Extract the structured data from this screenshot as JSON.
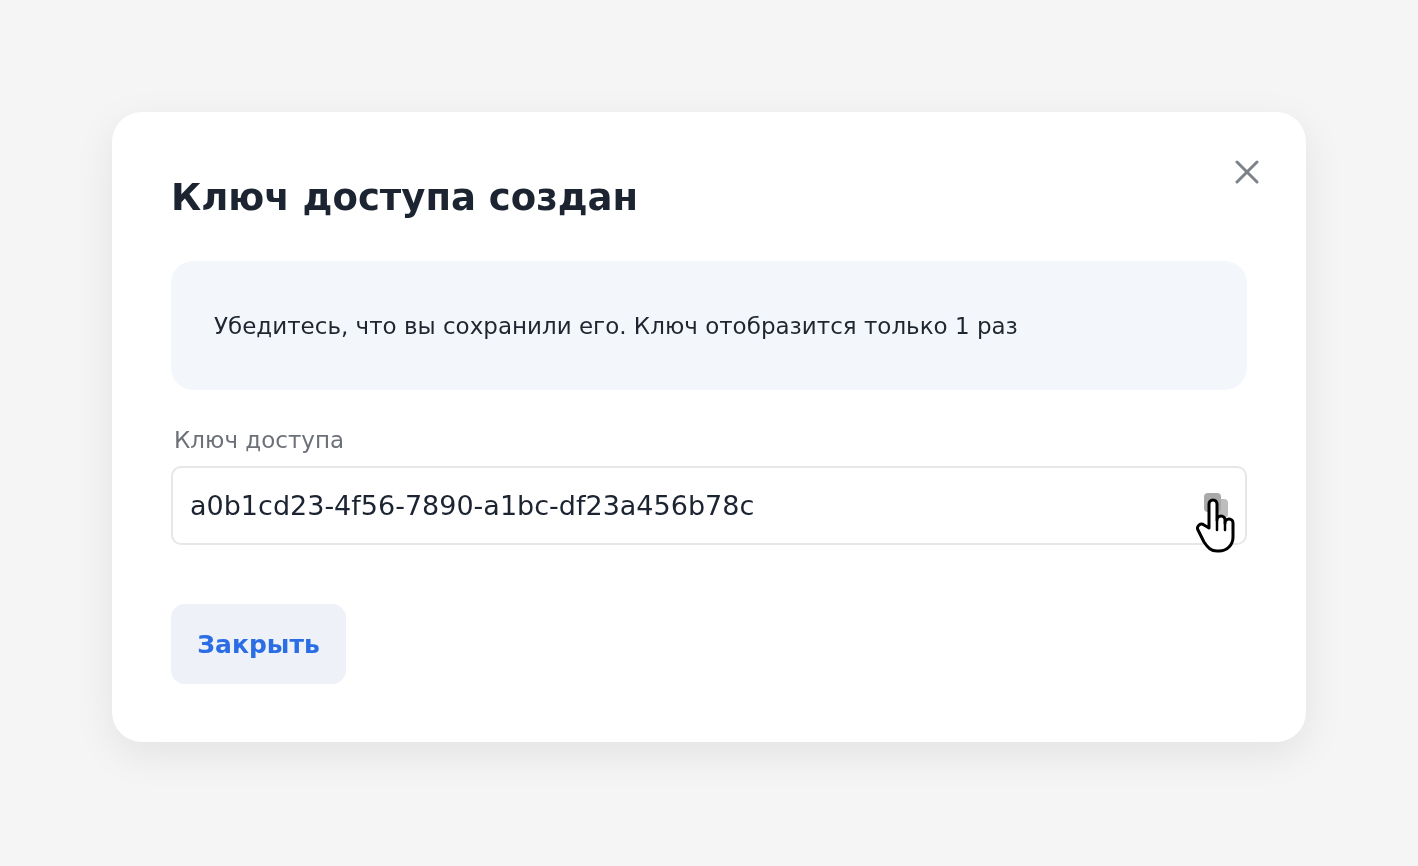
{
  "dialog": {
    "title": "Ключ доступа создан",
    "notice": "Убедитесь, что вы сохранили его. Ключ отобразится только 1 раз",
    "field": {
      "label": "Ключ доступа",
      "value": "a0b1cd23-4f56-7890-a1bc-df23a456b78c"
    },
    "buttons": [
      "Закрыть"
    ]
  }
}
